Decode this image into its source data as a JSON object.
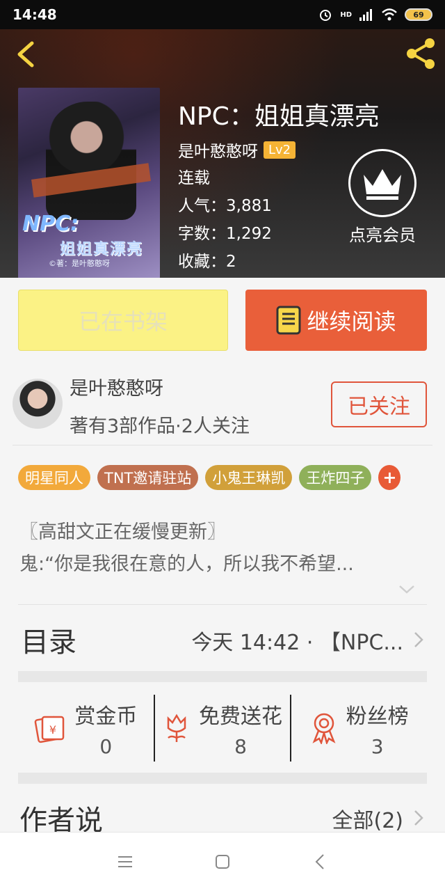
{
  "status_bar": {
    "time": "14:48",
    "network": "HD",
    "battery": "69"
  },
  "book": {
    "title": "NPC：姐姐真漂亮",
    "author": "是叶憨憨呀",
    "level": "Lv2",
    "status": "连载",
    "popularity": "人气：3,881",
    "word_count": "字数：1,292",
    "favorites": "收藏：2",
    "cover": {
      "title": "NPC:",
      "subtitle": "姐姐真漂亮",
      "author": "©著：是叶憨憨呀"
    }
  },
  "vip": {
    "label": "点亮会员"
  },
  "actions": {
    "shelf_label": "已在书架",
    "read_label": "继续阅读"
  },
  "author_card": {
    "name": "是叶憨憨呀",
    "stats": "著有3部作品·2人关注",
    "follow_label": "已关注"
  },
  "tags": [
    {
      "label": "明星同人",
      "color": "#f2a93b"
    },
    {
      "label": "TNT邀请驻站",
      "color": "#c0704f"
    },
    {
      "label": "小鬼王琳凯",
      "color": "#d1a03a"
    },
    {
      "label": "王炸四子",
      "color": "#8fb05a"
    }
  ],
  "tag_more": "+",
  "description": {
    "line1": "〖高甜文正在缓慢更新〗",
    "line2": "鬼:“你是我很在意的人，所以我不希望..."
  },
  "toc": {
    "title": "目录",
    "latest": "今天 14:42 · 【NPC..."
  },
  "stats": [
    {
      "label": "赏金币",
      "value": "0",
      "icon": "red-envelope-icon"
    },
    {
      "label": "免费送花",
      "value": "8",
      "icon": "flower-icon"
    },
    {
      "label": "粉丝榜",
      "value": "3",
      "icon": "medal-icon"
    }
  ],
  "author_says": {
    "title": "作者说",
    "all_label": "全部(2)"
  },
  "colors": {
    "accent": "#e95f3a",
    "shelf_bg": "#fbf285",
    "icon_red": "#e0553b"
  }
}
